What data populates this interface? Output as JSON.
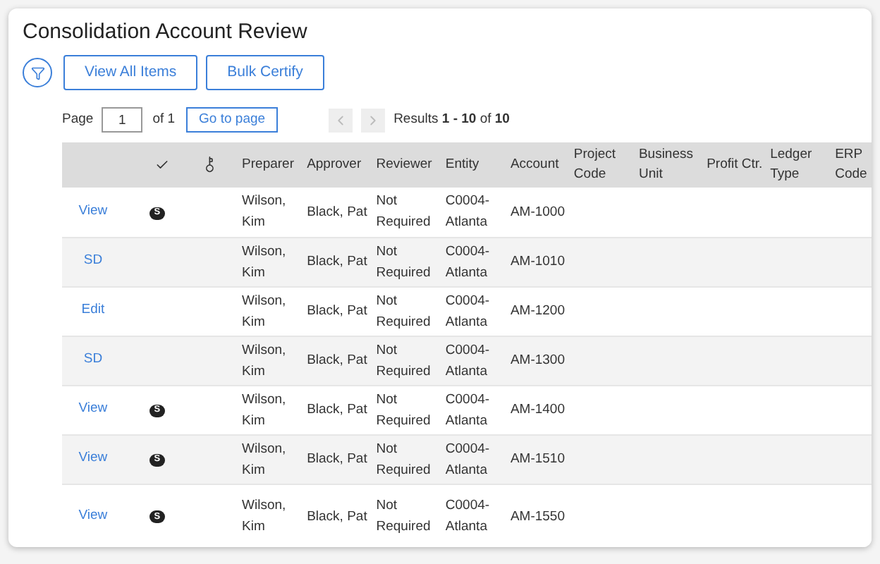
{
  "title": "Consolidation Account Review",
  "toolbar": {
    "buttons": [
      "View All Items",
      "Bulk Certify"
    ]
  },
  "pagination": {
    "page_label": "Page",
    "page_value": "1",
    "of_label": "of 1",
    "go_button": "Go to page",
    "prev_disabled": true,
    "next_disabled": true,
    "results": "Results **1 - 10** of **10**"
  },
  "table": {
    "columns": [
      "",
      "",
      "",
      "Preparer",
      "Approver",
      "Reviewer",
      "Entity",
      "Account",
      "Project Code",
      "Business Unit",
      "Profit Ctr.",
      "Ledger Type",
      "ERP Code"
    ],
    "rows": [
      {
        "action": "View",
        "badge": "S",
        "preparer": "Wilson, Kim",
        "approver": "Black, Pat",
        "reviewer": "Not Required",
        "entity": "C0004-Atlanta",
        "account": "AM-1000"
      },
      {
        "action": "SD",
        "preparer": "Wilson, Kim",
        "approver": "Black, Pat",
        "reviewer": "Not Required",
        "entity": "C0004-Atlanta",
        "account": "AM-1010"
      },
      {
        "action": "Edit",
        "preparer": "Wilson, Kim",
        "approver": "Black, Pat",
        "reviewer": "Not Required",
        "entity": "C0004-Atlanta",
        "account": "AM-1200"
      },
      {
        "action": "SD",
        "preparer": "Wilson, Kim",
        "approver": "Black, Pat",
        "reviewer": "Not Required",
        "entity": "C0004-Atlanta",
        "account": "AM-1300"
      },
      {
        "action": "View",
        "badge": "S",
        "preparer": "Wilson, Kim",
        "approver": "Black, Pat",
        "reviewer": "Not Required",
        "entity": "C0004-Atlanta",
        "account": "AM-1400"
      },
      {
        "action": "View",
        "badge": "S",
        "preparer": "Wilson, Kim",
        "approver": "Black, Pat",
        "reviewer": "Not Required",
        "entity": "C0004-Atlanta",
        "account": "AM-1510"
      },
      {
        "action": "View",
        "badge": "S",
        "preparer": "Wilson, Kim",
        "approver": "Black, Pat",
        "reviewer": "Not Required",
        "entity": "C0004-Atlanta",
        "account": "AM-1550"
      }
    ]
  }
}
